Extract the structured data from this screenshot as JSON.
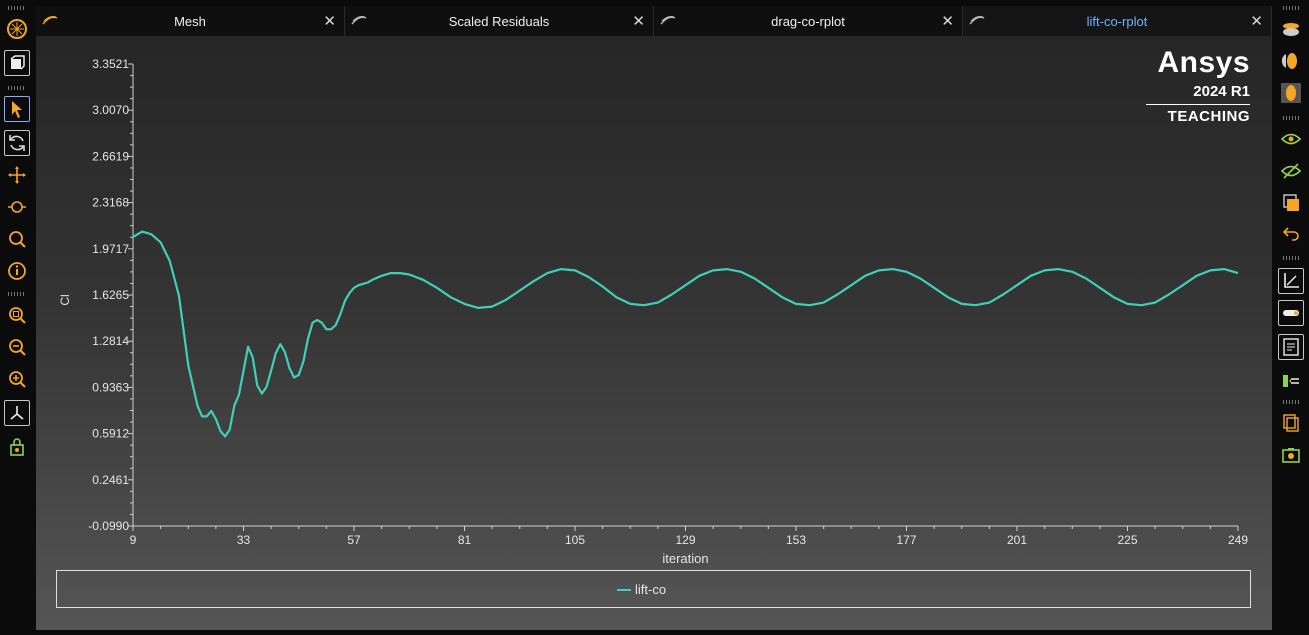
{
  "tabs": [
    {
      "label": "Mesh",
      "active": false
    },
    {
      "label": "Scaled Residuals",
      "active": false
    },
    {
      "label": "drag-co-rplot",
      "active": false
    },
    {
      "label": "lift-co-rplot",
      "active": true
    }
  ],
  "tab_close_glyph": "✕",
  "brand": {
    "name": "Ansys",
    "version": "2024 R1",
    "edition": "TEACHING"
  },
  "colors": {
    "series": "#40d0b8",
    "active_tab_text": "#6fb3ff",
    "accent_orange": "#f5a623"
  },
  "left_toolbar": [
    "mesh-display-icon",
    "view-cube-icon",
    "pointer-select-icon",
    "rotate-icon",
    "pan-icon",
    "zoom-probe-icon",
    "zoom-icon",
    "info-icon",
    "zoom-fit-icon",
    "zoom-out-icon",
    "zoom-in-icon",
    "axes-icon",
    "lock-view-icon"
  ],
  "right_toolbar": [
    "top-view-icon",
    "front-view-icon",
    "iso-view-icon",
    "show-eye-icon",
    "hide-eye-icon",
    "copy-window-icon",
    "undo-view-icon",
    "axes-plot-icon",
    "toggle-icon",
    "report-icon",
    "legend-icon",
    "duplicate-icon",
    "screenshot-icon"
  ],
  "chart_data": {
    "type": "line",
    "xlabel": "iteration",
    "ylabel": "Cl",
    "xlim": [
      9,
      249
    ],
    "ylim": [
      -0.099,
      3.3521
    ],
    "x_ticks": [
      "9",
      "33",
      "57",
      "81",
      "105",
      "129",
      "153",
      "177",
      "201",
      "225",
      "249"
    ],
    "y_ticks": [
      "3.3521",
      "3.0070",
      "2.6619",
      "2.3168",
      "1.9717",
      "1.6265",
      "1.2814",
      "0.9363",
      "0.5912",
      "0.2461",
      "-0.0990"
    ],
    "grid": false,
    "legend_position": "bottom",
    "series": [
      {
        "name": "lift-co",
        "x": [
          9,
          11,
          13,
          15,
          17,
          19,
          21,
          23,
          24,
          25,
          26,
          27,
          28,
          29,
          30,
          31,
          32,
          33,
          34,
          35,
          36,
          37,
          38,
          39,
          40,
          41,
          42,
          43,
          44,
          45,
          46,
          47,
          48,
          49,
          50,
          51,
          52,
          53,
          54,
          55,
          56,
          57,
          58,
          59,
          60,
          61,
          63,
          65,
          67,
          69,
          72,
          75,
          78,
          81,
          84,
          87,
          90,
          93,
          96,
          99,
          102,
          105,
          108,
          111,
          114,
          117,
          120,
          123,
          126,
          129,
          132,
          135,
          138,
          141,
          144,
          147,
          150,
          153,
          156,
          159,
          162,
          165,
          168,
          171,
          174,
          177,
          180,
          183,
          186,
          189,
          192,
          195,
          198,
          201,
          204,
          207,
          210,
          213,
          216,
          219,
          222,
          225,
          228,
          231,
          234,
          237,
          240,
          243,
          246,
          249
        ],
        "y": [
          2.06,
          2.1,
          2.08,
          2.02,
          1.88,
          1.62,
          1.1,
          0.8,
          0.72,
          0.72,
          0.76,
          0.7,
          0.61,
          0.57,
          0.62,
          0.8,
          0.88,
          1.06,
          1.24,
          1.16,
          0.95,
          0.89,
          0.94,
          1.06,
          1.19,
          1.26,
          1.2,
          1.08,
          1.01,
          1.03,
          1.13,
          1.3,
          1.42,
          1.44,
          1.42,
          1.37,
          1.37,
          1.4,
          1.48,
          1.58,
          1.64,
          1.68,
          1.7,
          1.71,
          1.72,
          1.74,
          1.77,
          1.79,
          1.79,
          1.78,
          1.74,
          1.68,
          1.61,
          1.56,
          1.53,
          1.54,
          1.59,
          1.66,
          1.73,
          1.79,
          1.82,
          1.81,
          1.76,
          1.69,
          1.61,
          1.56,
          1.55,
          1.57,
          1.63,
          1.7,
          1.77,
          1.81,
          1.82,
          1.8,
          1.75,
          1.68,
          1.61,
          1.56,
          1.55,
          1.57,
          1.63,
          1.7,
          1.77,
          1.81,
          1.82,
          1.8,
          1.75,
          1.68,
          1.61,
          1.56,
          1.55,
          1.57,
          1.63,
          1.7,
          1.77,
          1.81,
          1.82,
          1.8,
          1.75,
          1.68,
          1.61,
          1.56,
          1.55,
          1.57,
          1.63,
          1.7,
          1.77,
          1.81,
          1.82,
          1.79
        ]
      }
    ]
  }
}
